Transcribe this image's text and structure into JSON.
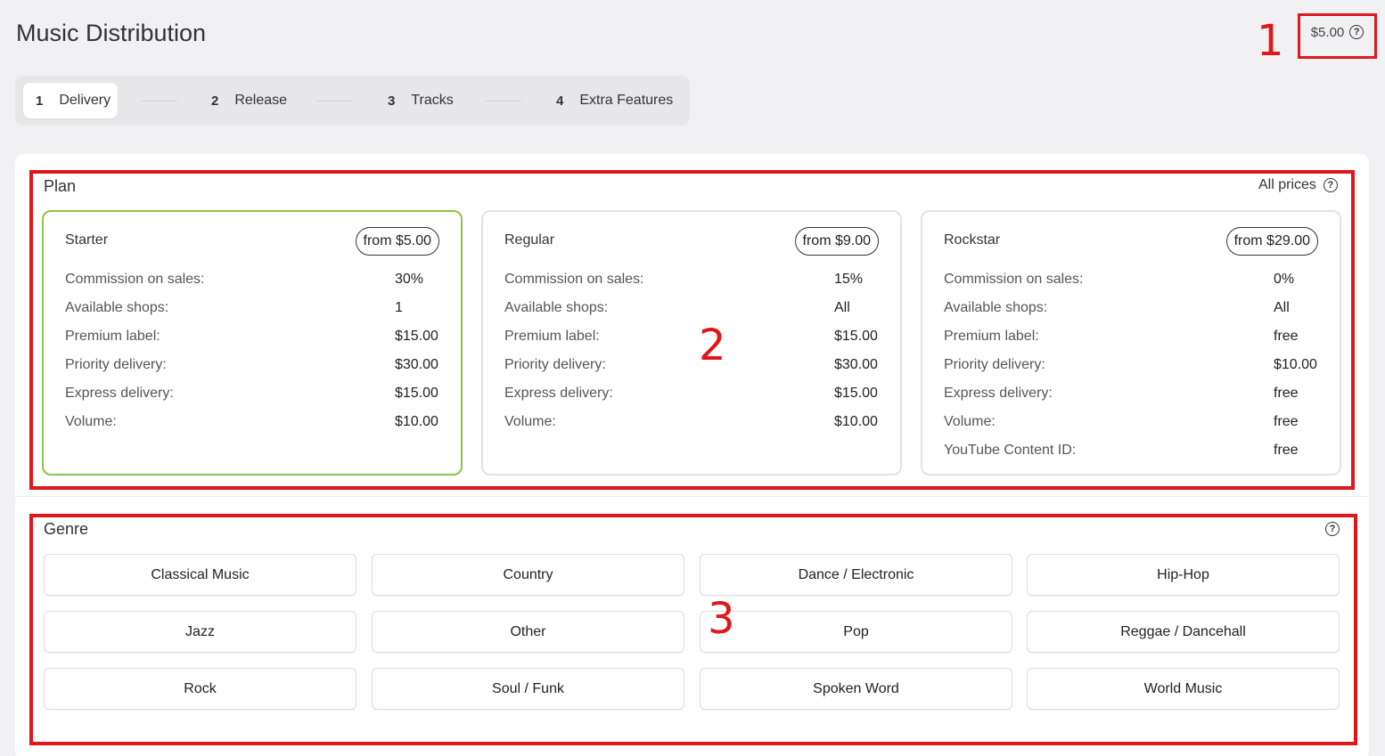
{
  "header": {
    "title": "Music Distribution",
    "total_price": "$5.00"
  },
  "annotations": [
    "1",
    "2",
    "3"
  ],
  "steps": [
    {
      "num": "1",
      "label": "Delivery",
      "active": true
    },
    {
      "num": "2",
      "label": "Release"
    },
    {
      "num": "3",
      "label": "Tracks"
    },
    {
      "num": "4",
      "label": "Extra Features"
    }
  ],
  "plan_section": {
    "title": "Plan",
    "all_prices_label": "All prices",
    "plans": [
      {
        "name": "Starter",
        "price": "from $5.00",
        "selected": true,
        "features": [
          {
            "label": "Commission on sales:",
            "value": "30%"
          },
          {
            "label": "Available shops:",
            "value": "1"
          },
          {
            "label": "Premium label:",
            "value": "$15.00"
          },
          {
            "label": "Priority delivery:",
            "value": "$30.00"
          },
          {
            "label": "Express delivery:",
            "value": "$15.00"
          },
          {
            "label": "Volume:",
            "value": "$10.00"
          }
        ]
      },
      {
        "name": "Regular",
        "price": "from $9.00",
        "features": [
          {
            "label": "Commission on sales:",
            "value": "15%"
          },
          {
            "label": "Available shops:",
            "value": "All"
          },
          {
            "label": "Premium label:",
            "value": "$15.00"
          },
          {
            "label": "Priority delivery:",
            "value": "$30.00"
          },
          {
            "label": "Express delivery:",
            "value": "$15.00"
          },
          {
            "label": "Volume:",
            "value": "$10.00"
          }
        ]
      },
      {
        "name": "Rockstar",
        "price": "from $29.00",
        "features": [
          {
            "label": "Commission on sales:",
            "value": "0%"
          },
          {
            "label": "Available shops:",
            "value": "All"
          },
          {
            "label": "Premium label:",
            "value": "free"
          },
          {
            "label": "Priority delivery:",
            "value": "$10.00"
          },
          {
            "label": "Express delivery:",
            "value": "free"
          },
          {
            "label": "Volume:",
            "value": "free"
          },
          {
            "label": "YouTube Content ID:",
            "value": "free"
          }
        ]
      }
    ]
  },
  "genre_section": {
    "title": "Genre",
    "genres": [
      "Classical Music",
      "Country",
      "Dance / Electronic",
      "Hip-Hop",
      "Jazz",
      "Other",
      "Pop",
      "Reggae / Dancehall",
      "Rock",
      "Soul / Funk",
      "Spoken Word",
      "World Music"
    ]
  },
  "colors": {
    "annotation": "#e0161b",
    "selected_plan_border": "#8bc34a"
  }
}
